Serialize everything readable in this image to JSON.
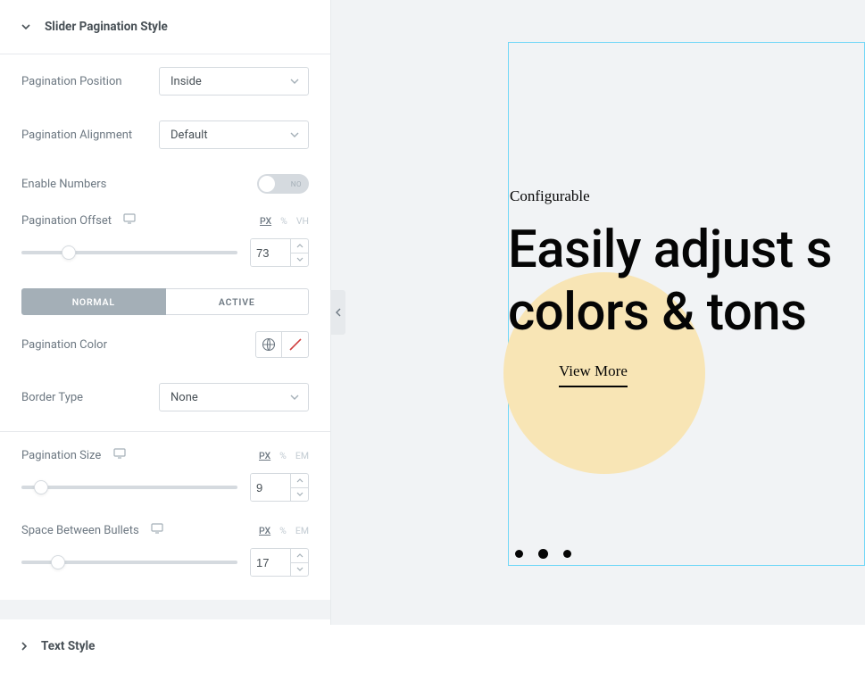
{
  "section": {
    "title": "Slider Pagination Style"
  },
  "pagination_position": {
    "label": "Pagination Position",
    "value": "Inside"
  },
  "pagination_alignment": {
    "label": "Pagination Alignment",
    "value": "Default"
  },
  "enable_numbers": {
    "label": "Enable Numbers",
    "value_label": "NO"
  },
  "pagination_offset": {
    "label": "Pagination Offset",
    "value": "73",
    "units": [
      "PX",
      "%",
      "VH"
    ],
    "active_unit": "PX",
    "thumb_pct": 22
  },
  "tabs": {
    "normal": "NORMAL",
    "active": "ACTIVE"
  },
  "pagination_color": {
    "label": "Pagination Color"
  },
  "border_type": {
    "label": "Border Type",
    "value": "None"
  },
  "pagination_size": {
    "label": "Pagination Size",
    "value": "9",
    "units": [
      "PX",
      "%",
      "EM"
    ],
    "active_unit": "PX",
    "thumb_pct": 9
  },
  "space_between": {
    "label": "Space Between Bullets",
    "value": "17",
    "units": [
      "PX",
      "%",
      "EM"
    ],
    "active_unit": "PX",
    "thumb_pct": 17
  },
  "text_style": {
    "title": "Text Style"
  },
  "preview": {
    "eyebrow": "Configurable",
    "headline_1": "Easily adjust s",
    "headline_2": "colors & tons",
    "cta": "View More"
  }
}
